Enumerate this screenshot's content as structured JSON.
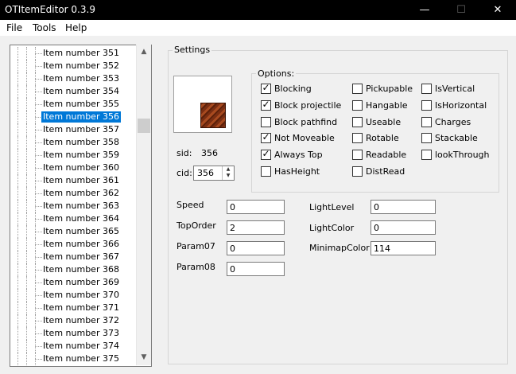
{
  "window": {
    "title": "OTItemEditor 0.3.9",
    "minimize": "—",
    "maximize": "☐",
    "close": "✕"
  },
  "menu": {
    "file": "File",
    "tools": "Tools",
    "help": "Help"
  },
  "tree": {
    "items": [
      "Item number 351",
      "Item number 352",
      "Item number 353",
      "Item number 354",
      "Item number 355",
      "Item number 356",
      "Item number 357",
      "Item number 358",
      "Item number 359",
      "Item number 360",
      "Item number 361",
      "Item number 362",
      "Item number 363",
      "Item number 364",
      "Item number 365",
      "Item number 366",
      "Item number 367",
      "Item number 368",
      "Item number 369",
      "Item number 370",
      "Item number 371",
      "Item number 372",
      "Item number 373",
      "Item number 374",
      "Item number 375"
    ],
    "selected_index": 5
  },
  "settings": {
    "title": "Settings",
    "sid_label": "sid:",
    "sid_value": "356",
    "cid_label": "cid:",
    "cid_value": "356",
    "options_title": "Options:",
    "options": [
      {
        "label": "Blocking",
        "checked": true
      },
      {
        "label": "Block projectile",
        "checked": true
      },
      {
        "label": "Block pathfind",
        "checked": false
      },
      {
        "label": "Not Moveable",
        "checked": true
      },
      {
        "label": "Always Top",
        "checked": true
      },
      {
        "label": "HasHeight",
        "checked": false
      },
      {
        "label": "Pickupable",
        "checked": false
      },
      {
        "label": "Hangable",
        "checked": false
      },
      {
        "label": "Useable",
        "checked": false
      },
      {
        "label": "Rotable",
        "checked": false
      },
      {
        "label": "Readable",
        "checked": false
      },
      {
        "label": "DistRead",
        "checked": false
      },
      {
        "label": "IsVertical",
        "checked": false
      },
      {
        "label": "IsHorizontal",
        "checked": false
      },
      {
        "label": "Charges",
        "checked": false
      },
      {
        "label": "Stackable",
        "checked": false
      },
      {
        "label": "lookThrough",
        "checked": false
      }
    ],
    "fields": {
      "speed_label": "Speed",
      "speed_value": "0",
      "toporder_label": "TopOrder",
      "toporder_value": "2",
      "param07_label": "Param07",
      "param07_value": "0",
      "param08_label": "Param08",
      "param08_value": "0",
      "lightlevel_label": "LightLevel",
      "lightlevel_value": "0",
      "lightcolor_label": "LightColor",
      "lightcolor_value": "0",
      "minimapcolor_label": "MinimapColor",
      "minimapcolor_value": "114"
    }
  },
  "colors": {
    "selection": "#0078d7",
    "titlebar": "#000000"
  }
}
